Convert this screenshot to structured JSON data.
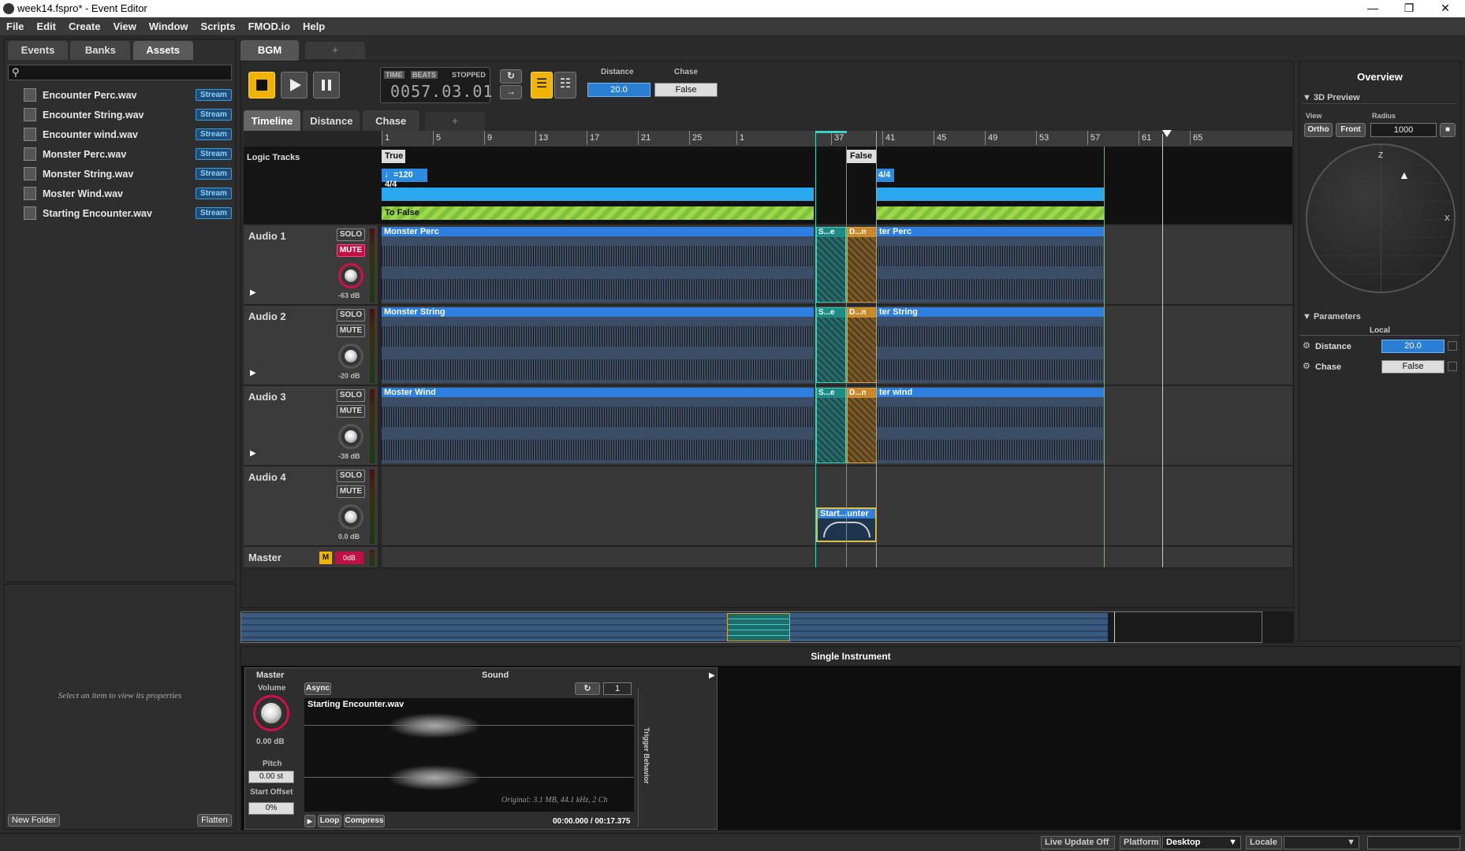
{
  "window": {
    "title": "week14.fspro* - Event Editor"
  },
  "menu": [
    "File",
    "Edit",
    "Create",
    "View",
    "Window",
    "Scripts",
    "FMOD.io",
    "Help"
  ],
  "browser": {
    "tabs": [
      "Events",
      "Banks",
      "Assets"
    ],
    "active_tab": "Assets",
    "search_placeholder": "",
    "assets": [
      {
        "name": "Encounter Perc.wav",
        "badge": "Stream"
      },
      {
        "name": "Encounter String.wav",
        "badge": "Stream"
      },
      {
        "name": "Encounter wind.wav",
        "badge": "Stream"
      },
      {
        "name": "Monster Perc.wav",
        "badge": "Stream"
      },
      {
        "name": "Monster String.wav",
        "badge": "Stream"
      },
      {
        "name": "Moster Wind.wav",
        "badge": "Stream"
      },
      {
        "name": "Starting Encounter.wav",
        "badge": "Stream"
      }
    ],
    "properties_hint": "Select an item to view its properties",
    "new_folder": "New Folder",
    "flatten": "Flatten"
  },
  "event": {
    "tab": "BGM",
    "add_tab": "+",
    "transport": {
      "time_mode": "TIME",
      "beats_mode": "BEATS",
      "state": "STOPPED",
      "position": "0057.03.01"
    },
    "params": [
      {
        "label": "Distance",
        "value": "20.0"
      },
      {
        "label": "Chase",
        "value": "False"
      }
    ],
    "subtabs": [
      "Timeline",
      "Distance",
      "Chase",
      "+"
    ],
    "ruler": [
      "1",
      "5",
      "9",
      "13",
      "17",
      "21",
      "25",
      "1",
      "37",
      "41",
      "45",
      "49",
      "53",
      "57",
      "61",
      "65"
    ],
    "logic": {
      "label": "Logic Tracks",
      "true_marker": "True",
      "false_marker": "False",
      "tempo": "♩=120 4/4",
      "tempo2": "4/4",
      "transition": "To False"
    },
    "tracks": [
      {
        "name": "Audio 1",
        "solo": "SOLO",
        "mute": "MUTE",
        "mute_on": true,
        "db": "-63 dB",
        "clip": "Monster Perc",
        "clip2": "ter Perc",
        "s": "S...e",
        "d": "D...n"
      },
      {
        "name": "Audio 2",
        "solo": "SOLO",
        "mute": "MUTE",
        "mute_on": false,
        "db": "-20 dB",
        "clip": "Monster String",
        "clip2": "ter String",
        "s": "S...e",
        "d": "D...n"
      },
      {
        "name": "Audio 3",
        "solo": "SOLO",
        "mute": "MUTE",
        "mute_on": false,
        "db": "-38 dB",
        "clip": "Moster Wind",
        "clip2": "ter wind",
        "s": "S...e",
        "d": "D...n"
      },
      {
        "name": "Audio 4",
        "solo": "SOLO",
        "mute": "MUTE",
        "mute_on": false,
        "db": "0.0 dB",
        "clip": "Start...unter"
      }
    ],
    "master": {
      "name": "Master",
      "m": "M",
      "value": "0dB"
    }
  },
  "overview": {
    "title": "Overview",
    "preview": "3D Preview",
    "view_label": "View",
    "radius_label": "Radius",
    "ortho": "Ortho",
    "front": "Front",
    "radius": "1000",
    "axis_z": "Z",
    "axis_x": "X",
    "parameters": "Parameters",
    "local": "Local",
    "param_rows": [
      {
        "name": "Distance",
        "value": "20.0"
      },
      {
        "name": "Chase",
        "value": "False"
      }
    ]
  },
  "deck": {
    "title": "Single Instrument",
    "master": "Master",
    "sound": "Sound",
    "volume_label": "Volume",
    "volume": "0.00 dB",
    "pitch_label": "Pitch",
    "pitch": "0.00 st",
    "offset_label": "Start Offset",
    "offset": "0%",
    "async": "Async",
    "loop_count": "1",
    "file": "Starting Encounter.wav",
    "info": "Original: 3.1 MB, 44.1 kHz, 2 Ch",
    "loop": "Loop",
    "compress": "Compress",
    "time": "00:00.000 / 00:17.375",
    "trigger": "Trigger Behavior"
  },
  "status": {
    "live_update": "Live Update Off",
    "platform_label": "Platform",
    "platform": "Desktop",
    "locale_label": "Locale"
  }
}
